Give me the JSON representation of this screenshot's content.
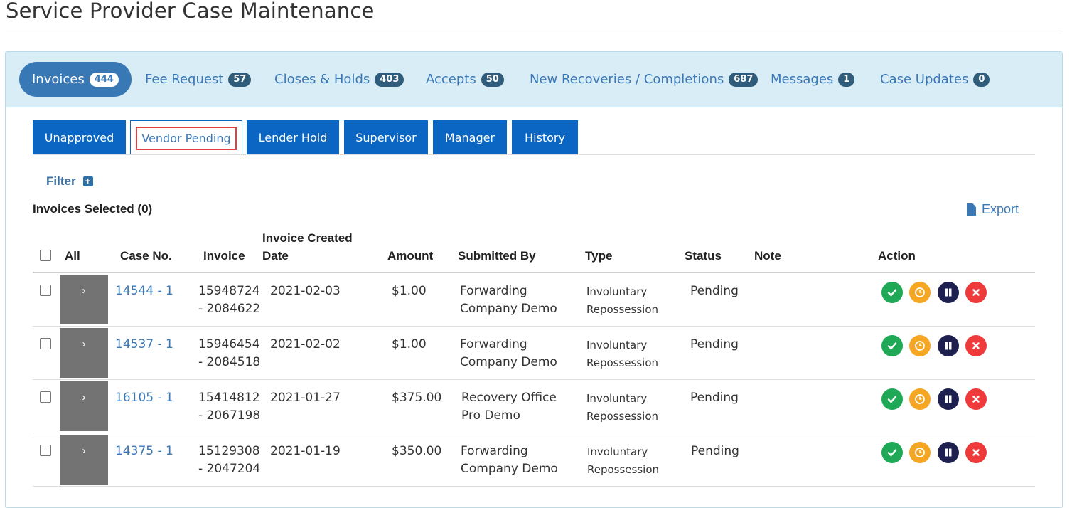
{
  "page": {
    "title": "Service Provider Case Maintenance"
  },
  "main_tabs": [
    {
      "label": "Invoices",
      "count": "444"
    },
    {
      "label": "Fee Request",
      "count": "57"
    },
    {
      "label": "Closes & Holds",
      "count": "403"
    },
    {
      "label": "Accepts",
      "count": "50"
    },
    {
      "label": "New Recoveries / Completions",
      "count": "687"
    },
    {
      "label": "Messages",
      "count": "1"
    },
    {
      "label": "Case Updates",
      "count": "0"
    }
  ],
  "sub_tabs": [
    {
      "label": "Unapproved"
    },
    {
      "label": "Vendor Pending"
    },
    {
      "label": "Lender Hold"
    },
    {
      "label": "Supervisor"
    },
    {
      "label": "Manager"
    },
    {
      "label": "History"
    }
  ],
  "filter": {
    "label": "Filter",
    "icon": "plus-square-icon"
  },
  "selection": {
    "label": "Invoices Selected (0)"
  },
  "export": {
    "label": "Export",
    "icon": "document-icon"
  },
  "table": {
    "headers": {
      "all": "All",
      "case_no": "Case No.",
      "invoice": "Invoice",
      "created_1": "Invoice Created",
      "created_2": "Date",
      "amount": "Amount",
      "submitted_by": "Submitted By",
      "type": "Type",
      "status": "Status",
      "note": "Note",
      "action": "Action"
    },
    "rows": [
      {
        "case": "14544 - 1",
        "inv1": "15948724",
        "inv2": "- 2084622",
        "date": "2021-02-03",
        "amount": "$1.00",
        "by1": "Forwarding",
        "by2": "Company Demo",
        "type1": "Involuntary",
        "type2": "Repossession",
        "status": "Pending",
        "note": ""
      },
      {
        "case": "14537 - 1",
        "inv1": "15946454",
        "inv2": "- 2084518",
        "date": "2021-02-02",
        "amount": "$1.00",
        "by1": "Forwarding",
        "by2": "Company Demo",
        "type1": "Involuntary",
        "type2": "Repossession",
        "status": "Pending",
        "note": ""
      },
      {
        "case": "16105 - 1",
        "inv1": "15414812",
        "inv2": "- 2067198",
        "date": "2021-01-27",
        "amount": "$375.00",
        "by1": "Recovery Office",
        "by2": "Pro Demo",
        "type1": "Involuntary",
        "type2": "Repossession",
        "status": "Pending",
        "note": ""
      },
      {
        "case": "14375 - 1",
        "inv1": "15129308",
        "inv2": "- 2047204",
        "date": "2021-01-19",
        "amount": "$350.00",
        "by1": "Forwarding",
        "by2": "Company Demo",
        "type1": "Involuntary",
        "type2": "Repossession",
        "status": "Pending",
        "note": ""
      }
    ],
    "expander_glyph": "›",
    "actions": [
      {
        "icon": "check-icon",
        "color": "#1fa855"
      },
      {
        "icon": "clock-icon",
        "color": "#f5a623"
      },
      {
        "icon": "pause-icon",
        "color": "#1e2050"
      },
      {
        "icon": "close-icon",
        "color": "#ee3a3a"
      }
    ]
  },
  "colors": {
    "accent": "#3878b5",
    "tab_blue": "#0a66c2",
    "highlight": "#e04040"
  }
}
